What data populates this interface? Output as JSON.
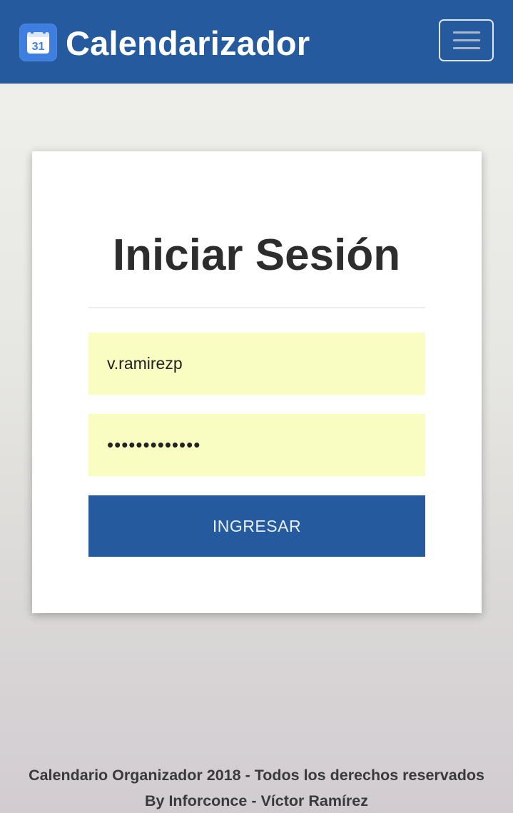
{
  "navbar": {
    "brand_title": "Calendarizador",
    "logo_icon": "calendar-31-icon",
    "logo_text": "31",
    "menu_icon": "hamburger-menu-icon",
    "color": "#255b9e"
  },
  "login": {
    "title": "Iniciar Sesión",
    "username_value": "v.ramirezp",
    "password_value": "•••••••••••••",
    "submit_label": "INGRESAR",
    "field_background": "#f9fdc1"
  },
  "footer": {
    "line1": "Calendario Organizador 2018 - Todos los derechos reservados",
    "line2": "By Inforconce - Víctor Ramírez"
  }
}
